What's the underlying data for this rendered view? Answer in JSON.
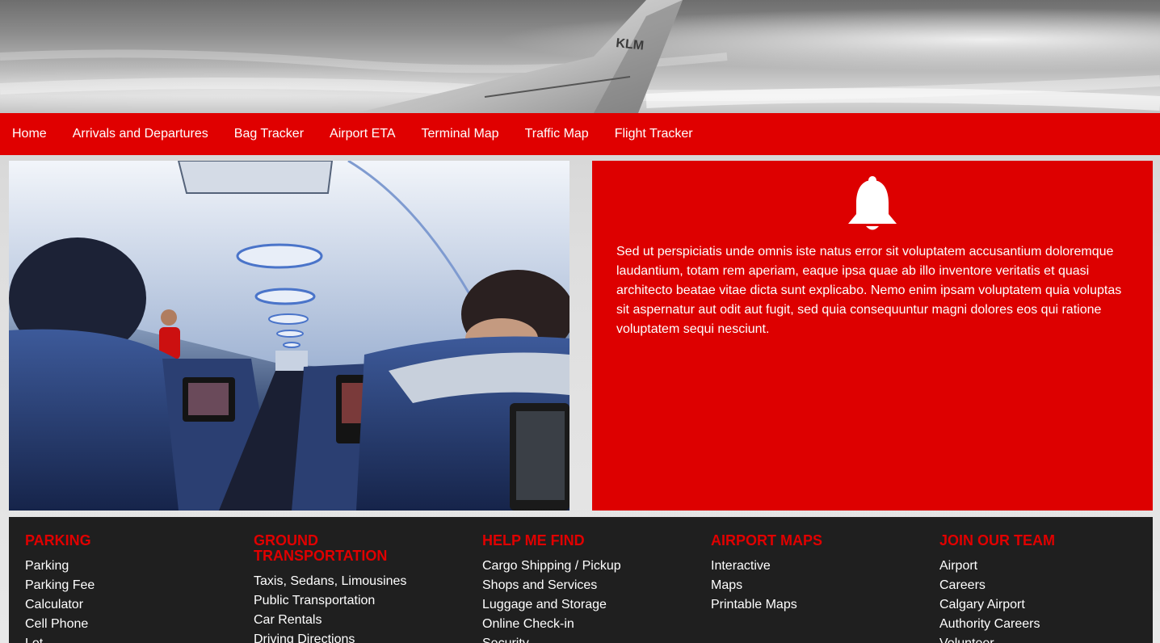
{
  "nav": {
    "items": [
      {
        "label": "Home"
      },
      {
        "label": "Arrivals and Departures"
      },
      {
        "label": "Bag Tracker"
      },
      {
        "label": "Airport ETA"
      },
      {
        "label": "Terminal Map"
      },
      {
        "label": "Traffic Map"
      },
      {
        "label": "Flight Tracker"
      }
    ]
  },
  "hero": {
    "wing_logo": "KLM"
  },
  "notice": {
    "icon": "bell-icon",
    "text": "Sed ut perspiciatis unde omnis iste natus error sit voluptatem accusantium doloremque laudantium, totam rem aperiam, eaque ipsa quae ab illo inventore veritatis et quasi architecto beatae vitae dicta sunt explicabo. Nemo enim ipsam voluptatem quia voluptas sit aspernatur aut odit aut fugit, sed quia consequuntur magni dolores eos qui ratione voluptatem sequi nesciunt."
  },
  "footer": {
    "columns": [
      {
        "heading": "PARKING",
        "links": [
          "Parking",
          "Parking Fee",
          "Calculator",
          "Cell Phone",
          "Lot"
        ]
      },
      {
        "heading": "GROUND TRANSPORTATION",
        "links": [
          "Taxis, Sedans, Limousines",
          "Public Transportation",
          "Car Rentals",
          "Driving Directions"
        ]
      },
      {
        "heading": "HELP ME FIND",
        "links": [
          "Cargo Shipping / Pickup",
          "Shops and Services",
          "Luggage and Storage",
          "Online Check-in",
          "Security"
        ]
      },
      {
        "heading": "AIRPORT MAPS",
        "links": [
          "Interactive",
          "Maps",
          "Printable Maps"
        ]
      },
      {
        "heading": "JOIN OUR TEAM",
        "links": [
          "Airport",
          "Careers",
          "Calgary Airport",
          "Authority Careers",
          "Volunteer"
        ]
      }
    ]
  },
  "colors": {
    "brand_red": "#e00000",
    "footer_bg": "#1f1f1f",
    "text_light": "#ffffff"
  }
}
